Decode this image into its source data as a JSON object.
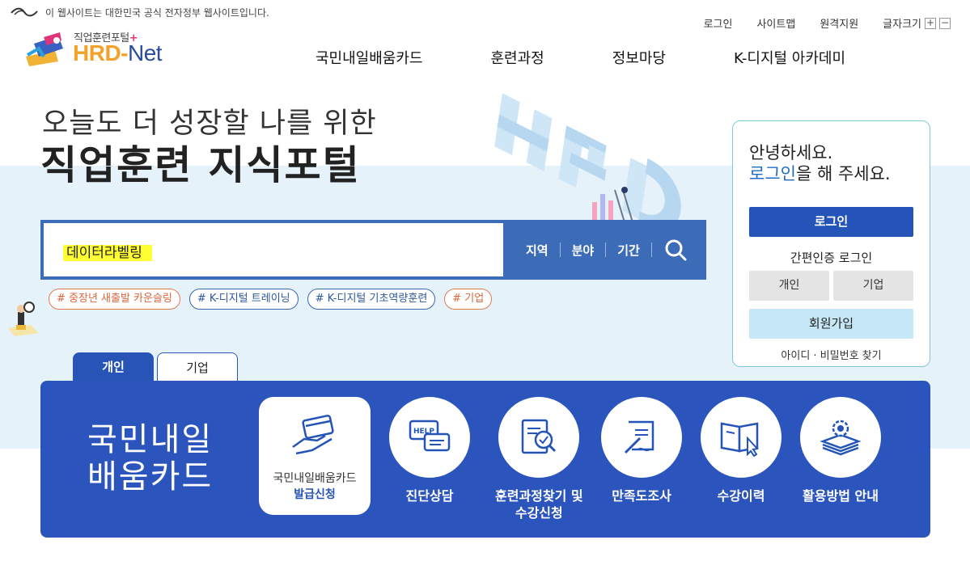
{
  "gov_bar": {
    "notice": "이 웹사이트는 대한민국 공식 전자정부 웹사이트입니다."
  },
  "util_nav": {
    "login": "로그인",
    "sitemap": "사이트맵",
    "remote_support": "원격지원",
    "font_size": "글자크기",
    "font_up": "+",
    "font_down": "−"
  },
  "logo": {
    "subtitle": "직업훈련포털",
    "plus": "+",
    "main": "HRD-",
    "net": "Net"
  },
  "main_nav": [
    "국민내일배움카드",
    "훈련과정",
    "정보마당",
    "K-디지털 아카데미"
  ],
  "hero": {
    "line1": "오늘도 더 성장할 나를 위한",
    "line2": "직업훈련 지식포털"
  },
  "search": {
    "value": "데이터라벨링",
    "filters": [
      "지역",
      "분야",
      "기간"
    ]
  },
  "tags": [
    {
      "label": "# 중장년 새출발 카운슬링",
      "color": "orange"
    },
    {
      "label": "# K-디지털 트레이닝",
      "color": "blue"
    },
    {
      "label": "# K-디지털 기초역량훈련",
      "color": "blue"
    },
    {
      "label": "# 기업",
      "color": "orange"
    }
  ],
  "login_panel": {
    "greet1": "안녕하세요.",
    "greet_link": "로그인",
    "greet2": "을 해 주세요.",
    "login_button": "로그인",
    "easy_login": "간편인증 로그인",
    "personal": "개인",
    "company": "기업",
    "join": "회원가입",
    "find": "아이디 · 비밀번호 찾기"
  },
  "tabs": {
    "personal": "개인",
    "company": "기업"
  },
  "card_section": {
    "title_line1": "국민내일",
    "title_line2": "배움카드",
    "featured": {
      "line1": "국민내일배움카드",
      "line2": "발급신청"
    },
    "features": [
      {
        "label": "진단상담",
        "icon": "help-chat-icon"
      },
      {
        "label": "훈련과정찾기 및",
        "label2": "수강신청",
        "icon": "document-search-icon"
      },
      {
        "label": "만족도조사",
        "icon": "survey-icon"
      },
      {
        "label": "수강이력",
        "icon": "book-click-icon"
      },
      {
        "label": "활용방법 안내",
        "icon": "gear-stack-icon"
      }
    ]
  },
  "colors": {
    "primary": "#2b55bd",
    "search": "#3c6bb7",
    "accent_orange": "#f2a22a",
    "band": "#e6f2fa"
  }
}
